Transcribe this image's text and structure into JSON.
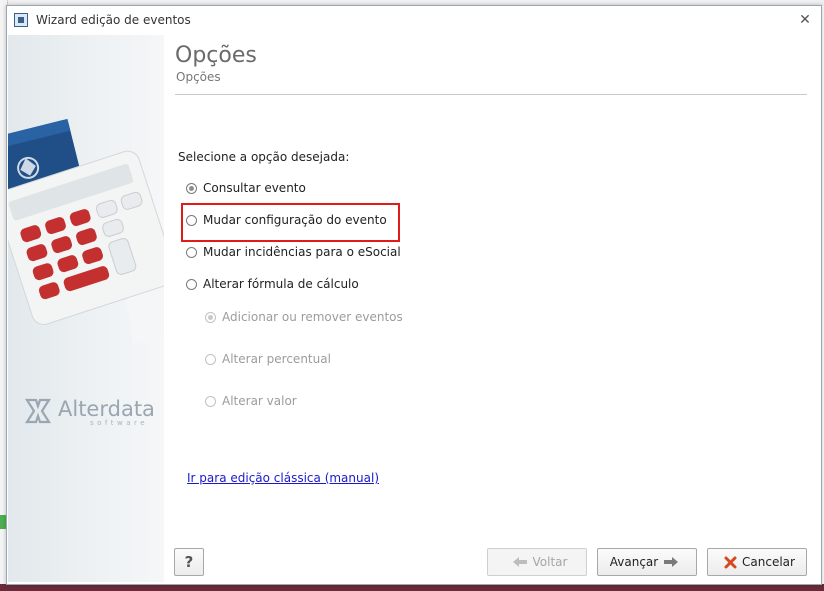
{
  "window": {
    "title": "Wizard edição de eventos"
  },
  "header": {
    "title": "Opções",
    "subtitle": "Opções"
  },
  "prompt": "Selecione a opção desejada:",
  "options": [
    {
      "label": "Consultar evento",
      "checked": true,
      "disabled": false
    },
    {
      "label": "Mudar configuração do evento",
      "checked": false,
      "disabled": false
    },
    {
      "label": "Mudar incidências para o eSocial",
      "checked": false,
      "disabled": false
    },
    {
      "label": "Alterar fórmula de cálculo",
      "checked": false,
      "disabled": false
    }
  ],
  "sub_options": [
    {
      "label": "Adicionar ou remover eventos",
      "checked": true,
      "disabled": true
    },
    {
      "label": "Alterar percentual",
      "checked": false,
      "disabled": true
    },
    {
      "label": "Alterar valor",
      "checked": false,
      "disabled": true
    }
  ],
  "classic_link": "Ir para edição clássica (manual)",
  "buttons": {
    "help": "?",
    "back": "Voltar",
    "next": "Avançar",
    "cancel": "Cancelar"
  },
  "logo": {
    "name": "Alterdata",
    "sub": "software"
  },
  "colors": {
    "highlight": "#e11a1a",
    "link": "#1a1acc",
    "cancel_icon": "#d9481c",
    "arrow_green": "#3a8a3a"
  }
}
